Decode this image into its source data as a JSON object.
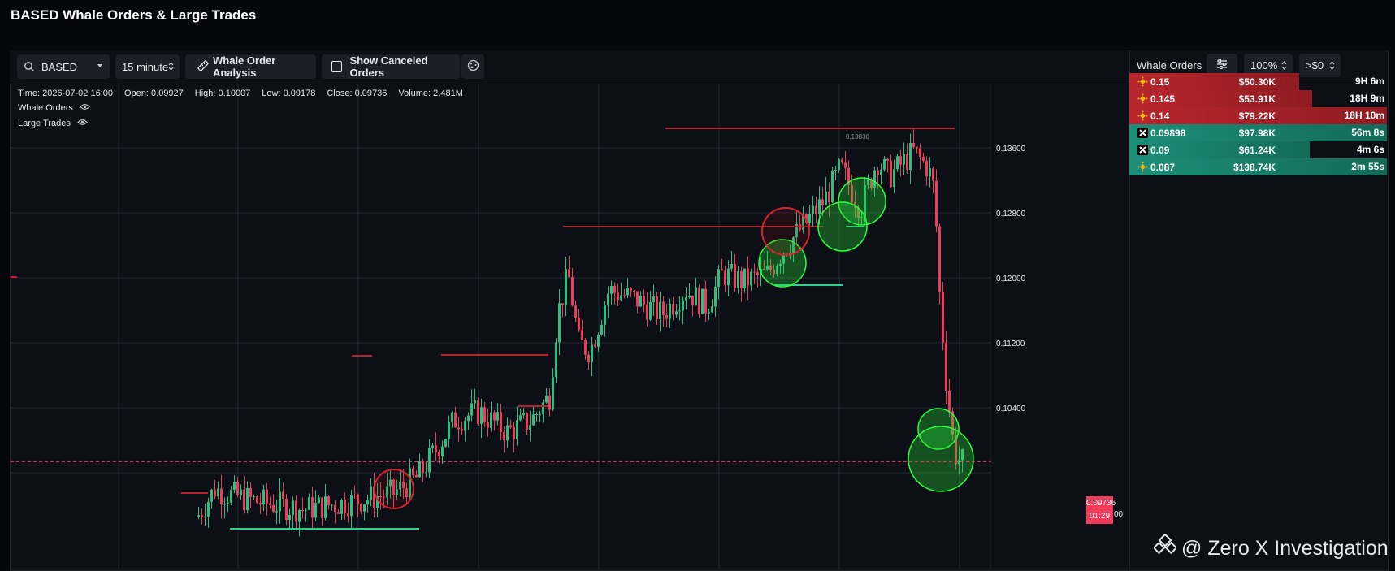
{
  "page": {
    "title": "BASED Whale Orders & Large Trades"
  },
  "toolbar": {
    "symbol": "BASED",
    "interval": "15 minute",
    "whale_analysis_label": "Whale Order Analysis",
    "show_canceled_label": "Show Canceled Orders",
    "show_canceled_checked": false
  },
  "ohlc": {
    "time": "Time: 2026-07-02 16:00",
    "open": "Open: 0.09927",
    "high": "High: 0.10007",
    "low": "Low: 0.09178",
    "close": "Close: 0.09736",
    "volume": "Volume: 2.481M"
  },
  "legend": {
    "whale_orders": "Whale Orders",
    "large_trades": "Large Trades"
  },
  "chart": {
    "y_ticks": [
      "0.13600",
      "0.12800",
      "0.12000",
      "0.11200",
      "0.10400"
    ],
    "top_marker": "0.13830",
    "current_price": "0.09736",
    "countdown": "01:29",
    "hidden_tick_fragment": "00",
    "colors": {
      "up": "#26c281",
      "down": "#f23b5a",
      "grid": "#232833"
    }
  },
  "whale_panel": {
    "title": "Whale Orders",
    "percent": "100%",
    "min_filter": ">$0",
    "orders": [
      {
        "side": "sell",
        "exchange": "binance",
        "price": "0.15",
        "amount": "$50.30K",
        "age": "9H 6m",
        "fill": 0.66
      },
      {
        "side": "sell",
        "exchange": "binance",
        "price": "0.145",
        "amount": "$53.91K",
        "age": "18H 9m",
        "fill": 0.71
      },
      {
        "side": "sell",
        "exchange": "binance",
        "price": "0.14",
        "amount": "$79.22K",
        "age": "18H 10m",
        "fill": 1.0
      },
      {
        "side": "buy",
        "exchange": "okx",
        "price": "0.09898",
        "amount": "$97.98K",
        "age": "56m 8s",
        "fill": 1.0
      },
      {
        "side": "buy",
        "exchange": "okx",
        "price": "0.09",
        "amount": "$61.24K",
        "age": "4m 6s",
        "fill": 0.7
      },
      {
        "side": "buy",
        "exchange": "binance",
        "price": "0.087",
        "amount": "$138.74K",
        "age": "2m 55s",
        "fill": 1.0
      }
    ]
  },
  "watermark": {
    "text": "@ Zero X Investigation"
  }
}
